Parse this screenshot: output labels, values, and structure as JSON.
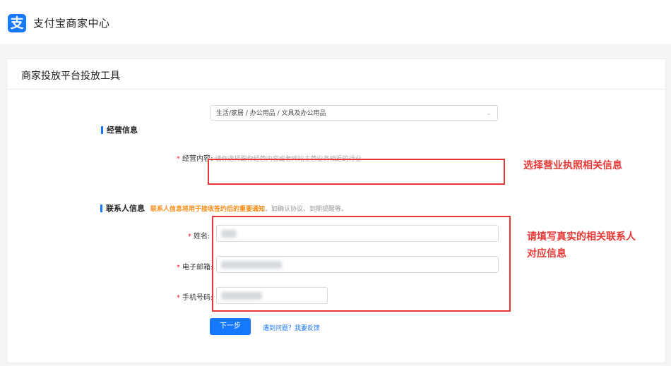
{
  "header": {
    "logo_char": "支",
    "brand_name": "支付宝商家中心"
  },
  "panel": {
    "title": "商家投放平台投放工具"
  },
  "business_section": {
    "heading": "经营信息",
    "content_label": "经营内容:",
    "content_hint": "请你选择跟你经营内容或者网站主营业务相近的行业",
    "content_value": "生活/家居 / 办公用品 / 文具及办公用品"
  },
  "contact_section": {
    "heading": "联系人信息",
    "notice_bold": "联系人信息将用于接收签约后的重要通知",
    "notice_rest": "，如确认协议、到期提醒等。",
    "name_label": "姓名:",
    "email_label": "电子邮箱:",
    "phone_label": "手机号码:"
  },
  "actions": {
    "next_label": "下一步",
    "help_label": "遇到问题？我要反馈"
  },
  "annotations": {
    "callout_1": "选择营业执照相关信息",
    "callout_2_line1": "请填写真实的相关联系人",
    "callout_2_line2": "对应信息"
  },
  "colors": {
    "brand_blue": "#1677ff",
    "annotation_red": "#e53935",
    "notice_orange": "#fa8c16"
  },
  "icons": {
    "logo": "alipay-logo-icon",
    "dropdown": "chevron-down-icon"
  }
}
